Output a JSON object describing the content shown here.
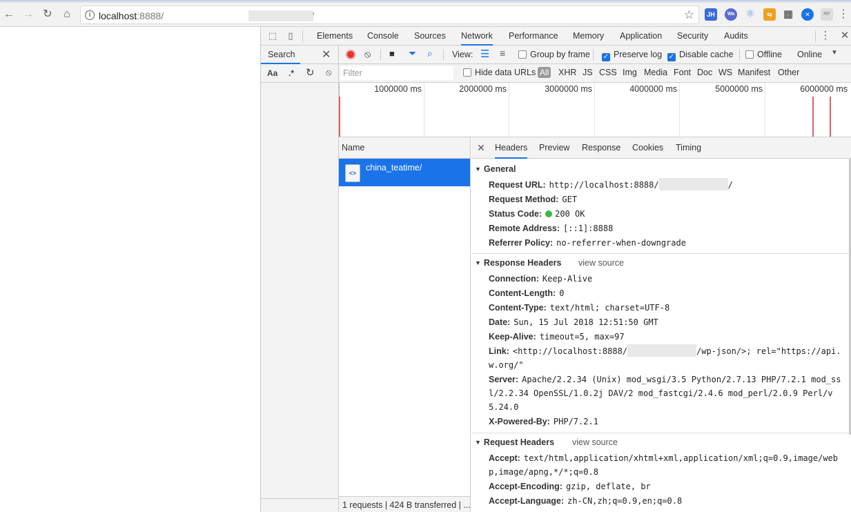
{
  "browser": {
    "url_host": "localhost",
    "url_port": ":8888/",
    "url_tail": "'"
  },
  "devtools": {
    "tabs": [
      "Elements",
      "Console",
      "Sources",
      "Network",
      "Performance",
      "Memory",
      "Application",
      "Security",
      "Audits"
    ],
    "active_tab": "Network"
  },
  "search": {
    "title": "Search",
    "case_label": "Aa",
    "regex_label": ".*"
  },
  "net_toolbar": {
    "view_label": "View:",
    "group_by_frame": "Group by frame",
    "preserve_log": "Preserve log",
    "disable_cache": "Disable cache",
    "offline": "Offline",
    "throttle": "Online"
  },
  "filter": {
    "placeholder": "Filter",
    "hide_data_urls": "Hide data URLs",
    "types": [
      "All",
      "XHR",
      "JS",
      "CSS",
      "Img",
      "Media",
      "Font",
      "Doc",
      "WS",
      "Manifest",
      "Other"
    ]
  },
  "overview": {
    "ticks": [
      "1000000 ms",
      "2000000 ms",
      "3000000 ms",
      "4000000 ms",
      "5000000 ms",
      "6000000 ms"
    ]
  },
  "request_list": {
    "header": "Name",
    "rows": [
      {
        "name": "china_teatime/"
      }
    ],
    "status": "1 requests | 424 B transferred | ..."
  },
  "details": {
    "tabs": [
      "Headers",
      "Preview",
      "Response",
      "Cookies",
      "Timing"
    ],
    "active_tab": "Headers",
    "view_source": "view source",
    "general": {
      "title": "General",
      "request_url_key": "Request URL:",
      "request_url_value": "http://localhost:8888/",
      "request_url_tail": "/",
      "request_method_key": "Request Method:",
      "request_method_value": "GET",
      "status_code_key": "Status Code:",
      "status_code_value": "200 OK",
      "remote_address_key": "Remote Address:",
      "remote_address_value": "[::1]:8888",
      "referrer_policy_key": "Referrer Policy:",
      "referrer_policy_value": "no-referrer-when-downgrade"
    },
    "response_headers": {
      "title": "Response Headers",
      "connection_key": "Connection:",
      "connection_value": "Keep-Alive",
      "content_length_key": "Content-Length:",
      "content_length_value": "0",
      "content_type_key": "Content-Type:",
      "content_type_value": "text/html; charset=UTF-8",
      "date_key": "Date:",
      "date_value": "Sun, 15 Jul 2018 12:51:50 GMT",
      "keep_alive_key": "Keep-Alive:",
      "keep_alive_value": "timeout=5, max=97",
      "link_key": "Link:",
      "link_value_a": "<http://localhost:8888/",
      "link_value_b": "/wp-json/>; rel=\"https://api.",
      "link_value_c": "w.org/\"",
      "server_key": "Server:",
      "server_value_a": "Apache/2.2.34 (Unix) mod_wsgi/3.5 Python/2.7.13 PHP/7.2.1 mod_ss",
      "server_value_b": "l/2.2.34 OpenSSL/1.0.2j DAV/2 mod_fastcgi/2.4.6 mod_perl/2.0.9 Perl/v",
      "server_value_c": "5.24.0",
      "powered_by_key": "X-Powered-By:",
      "powered_by_value": "PHP/7.2.1"
    },
    "request_headers": {
      "title": "Request Headers",
      "accept_key": "Accept:",
      "accept_value_a": "text/html,application/xhtml+xml,application/xml;q=0.9,image/web",
      "accept_value_b": "p,image/apng,*/*;q=0.8",
      "accept_encoding_key": "Accept-Encoding:",
      "accept_encoding_value": "gzip, deflate, br",
      "accept_language_key": "Accept-Language:",
      "accept_language_value": "zh-CN,zh;q=0.9,en;q=0.8"
    }
  },
  "extensions": [
    "JH",
    "Wa",
    "react",
    "ext",
    "qr",
    "x",
    "RP"
  ]
}
